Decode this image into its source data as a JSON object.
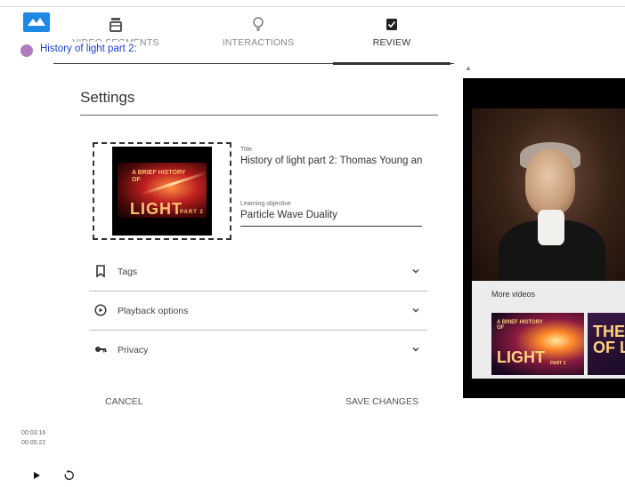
{
  "tabs": [
    {
      "label": "VIDEO SEGMENTS",
      "icon": "clapperboard-icon",
      "active": false
    },
    {
      "label": "INTERACTIONS",
      "icon": "lightbulb-icon",
      "active": false
    },
    {
      "label": "REVIEW",
      "icon": "checkbox-icon",
      "active": true
    }
  ],
  "settings": {
    "title": "Settings",
    "thumbnail": {
      "line1": "A BRIEF HISTORY",
      "line2": "OF",
      "line3": "LIGHT",
      "line4": "PART 2"
    },
    "title_field": {
      "label": "Title",
      "value": "History of light part 2: Thomas Young an"
    },
    "objective_field": {
      "label": "Learning objective",
      "value": "Particle Wave Duality"
    },
    "sections": [
      {
        "label": "Tags",
        "icon": "bookmark-icon"
      },
      {
        "label": "Playback options",
        "icon": "play-circle-icon"
      },
      {
        "label": "Privacy",
        "icon": "key-icon"
      }
    ],
    "cancel_label": "CANCEL",
    "save_label": "SAVE CHANGES"
  },
  "preview": {
    "video_title": "History of light part 2:",
    "more_label": "More videos",
    "thumb1": {
      "line1": "A BRIEF HISTORY",
      "line2": "OF",
      "line3": "LIGHT",
      "line4": "PART 2"
    },
    "thumb2": {
      "text": "THE OF L"
    }
  },
  "player": {
    "time_current": "00:03:16",
    "time_total": "00:05:22"
  },
  "colors": {
    "logo_blue": "#1e88e5",
    "title_link": "#1a3fd8",
    "preview_bg": "#000000"
  }
}
